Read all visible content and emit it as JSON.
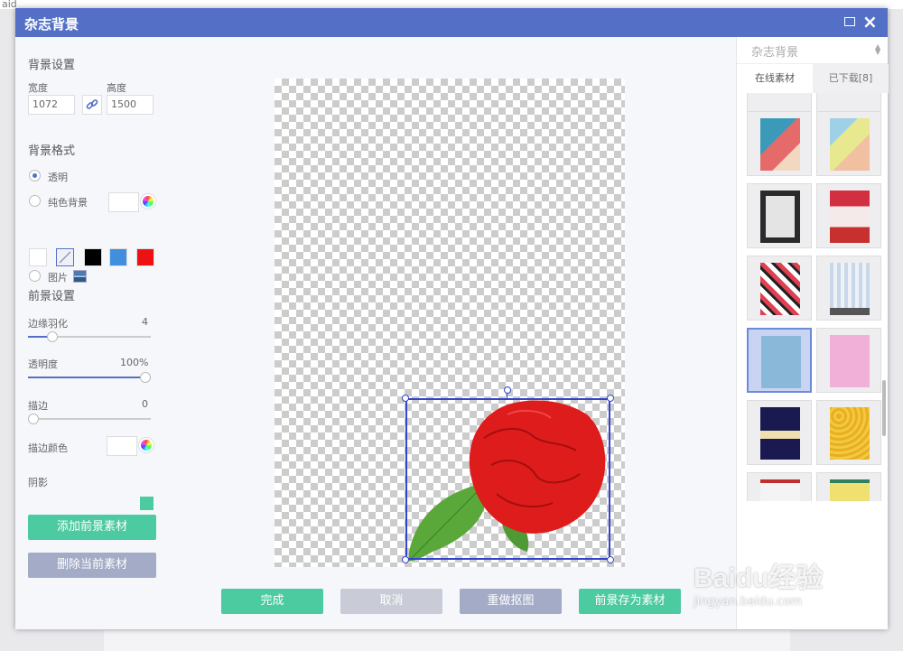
{
  "background_text": "aid",
  "window": {
    "title": "杂志背景"
  },
  "left": {
    "bg_settings_title": "背景设置",
    "width_label": "宽度",
    "width_value": "1072",
    "height_label": "高度",
    "height_value": "1500",
    "bg_format_title": "背景格式",
    "format_options": [
      "透明",
      "纯色背景",
      "图片"
    ],
    "selected_format": "透明",
    "swatch_colors": [
      "#ffffff",
      "transparent",
      "#000000",
      "#3f8fde",
      "#ee1111"
    ],
    "fg_settings_title": "前景设置",
    "feather_label": "边缘羽化",
    "feather_value": "4",
    "feather_level": 0.2,
    "opacity_label": "透明度",
    "opacity_value": "100%",
    "opacity_level": 1.0,
    "stroke_label": "描边",
    "stroke_value": "0",
    "stroke_level": 0,
    "stroke_color_label": "描边颜色",
    "shadow_label": "阴影",
    "shadow_color": "#4ccaa0",
    "add_fg_button": "添加前景素材",
    "delete_fg_button": "删除当前素材"
  },
  "bottom_buttons": {
    "done": "完成",
    "cancel": "取消",
    "recut": "重做抠图",
    "save_fg": "前景存为素材"
  },
  "right": {
    "category": "杂志背景",
    "tabs": [
      "在线素材",
      "已下载[8]"
    ],
    "active_tab": "在线素材",
    "thumbnails": [
      "magazine-bg-1",
      "magazine-bg-2",
      "magazine-bg-3",
      "magazine-bg-4",
      "magazine-bg-5",
      "magazine-bg-6",
      "magazine-bg-7",
      "magazine-bg-8",
      "magazine-bg-9",
      "magazine-bg-10"
    ],
    "selected_thumbnail": 6
  },
  "watermark": {
    "main": "Baidu经验",
    "sub": "jingyan.baidu.com"
  },
  "colors": {
    "accent": "#5470c6",
    "green": "#4ccaa0",
    "disabled": "#c9ccd6",
    "secondary": "#a3abc6"
  }
}
